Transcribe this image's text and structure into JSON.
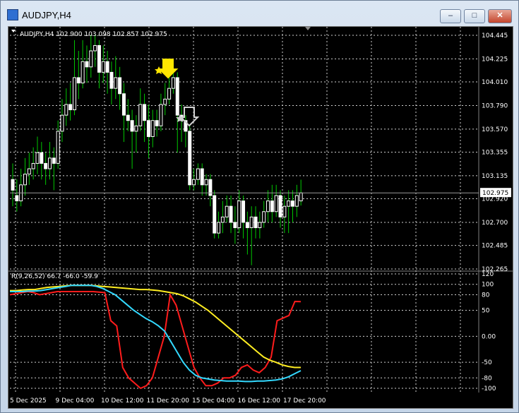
{
  "window": {
    "title": "AUDJPY,H4",
    "buttons": {
      "minimize": "–",
      "maximize": "□",
      "close": "✕"
    }
  },
  "chart": {
    "info_line": "AUDJPY,H4  102.900 103.098 102.857 102.975",
    "current_price": "102.975",
    "price_axis": [
      "104.445",
      "104.225",
      "104.010",
      "103.790",
      "103.570",
      "103.355",
      "103.135",
      "102.920",
      "102.700",
      "102.485",
      "102.265"
    ],
    "time_axis": [
      "5 Dec 2025",
      "9 Dec 04:00",
      "10 Dec 12:00",
      "11 Dec 20:00",
      "15 Dec 04:00",
      "16 Dec 12:00",
      "17 Dec 20:00"
    ],
    "indicator": {
      "label": "R(9,26,52) 66.7 -66.0 -59.9",
      "axis": [
        "120",
        "100",
        "80",
        "50",
        "0.00",
        "-50",
        "-80",
        "-100"
      ]
    },
    "arrows": [
      {
        "color": "#ffe600"
      },
      {
        "color": "#d0d0d0"
      }
    ]
  },
  "colors": {
    "up": "#ffffff",
    "down": "#ffffff",
    "wick": "#00c800",
    "red": "#ff1c1c",
    "yellow": "#ffee22",
    "cyan": "#33d9ff"
  },
  "chart_data": [
    {
      "type": "candlestick",
      "title": "AUDJPY,H4",
      "ylim": [
        102.265,
        104.445
      ],
      "y_ticks": [
        104.445,
        104.225,
        104.01,
        103.79,
        103.57,
        103.355,
        103.135,
        102.92,
        102.7,
        102.485,
        102.265
      ],
      "candles": [
        [
          103.1,
          103.0,
          103.25,
          102.85
        ],
        [
          102.95,
          102.9,
          103.1,
          102.8
        ],
        [
          102.9,
          103.05,
          103.2,
          102.85
        ],
        [
          103.05,
          103.15,
          103.3,
          102.95
        ],
        [
          103.15,
          103.2,
          103.35,
          103.05
        ],
        [
          103.2,
          103.25,
          103.4,
          103.1
        ],
        [
          103.25,
          103.35,
          103.5,
          103.15
        ],
        [
          103.35,
          103.25,
          103.45,
          103.1
        ],
        [
          103.25,
          103.2,
          103.35,
          103.05
        ],
        [
          103.2,
          103.3,
          103.45,
          103.1
        ],
        [
          103.3,
          103.25,
          103.4,
          103.0
        ],
        [
          103.25,
          103.55,
          103.65,
          103.2
        ],
        [
          103.55,
          103.7,
          103.85,
          103.45
        ],
        [
          103.7,
          103.8,
          103.95,
          103.6
        ],
        [
          103.8,
          103.75,
          104.0,
          103.65
        ],
        [
          103.75,
          104.05,
          104.4,
          103.7
        ],
        [
          104.05,
          104.0,
          104.3,
          103.85
        ],
        [
          104.0,
          104.2,
          104.4,
          103.95
        ],
        [
          104.2,
          104.15,
          104.35,
          104.0
        ],
        [
          104.15,
          104.3,
          104.45,
          104.05
        ],
        [
          104.3,
          104.35,
          104.45,
          104.15
        ],
        [
          104.35,
          104.1,
          104.4,
          103.95
        ],
        [
          104.1,
          104.2,
          104.35,
          104.0
        ],
        [
          104.2,
          104.1,
          104.3,
          103.9
        ],
        [
          104.1,
          103.95,
          104.2,
          103.8
        ],
        [
          103.95,
          104.05,
          104.25,
          103.85
        ],
        [
          104.05,
          103.9,
          104.15,
          103.75
        ],
        [
          103.9,
          103.7,
          104.0,
          103.45
        ],
        [
          103.7,
          103.65,
          103.85,
          103.55
        ],
        [
          103.65,
          103.55,
          103.75,
          103.2
        ],
        [
          103.55,
          103.6,
          103.7,
          103.35
        ],
        [
          103.6,
          103.8,
          103.95,
          103.55
        ],
        [
          103.8,
          103.65,
          103.9,
          103.45
        ],
        [
          103.65,
          103.5,
          103.8,
          103.3
        ],
        [
          103.5,
          103.65,
          103.75,
          103.4
        ],
        [
          103.65,
          103.6,
          103.75,
          103.5
        ],
        [
          103.6,
          103.8,
          103.9,
          103.55
        ],
        [
          103.8,
          103.85,
          104.0,
          103.7
        ],
        [
          103.85,
          103.95,
          104.1,
          103.8
        ],
        [
          103.95,
          104.05,
          104.15,
          103.9
        ],
        [
          104.05,
          103.7,
          104.1,
          103.35
        ],
        [
          103.7,
          103.65,
          103.8,
          103.45
        ],
        [
          103.65,
          103.55,
          103.7,
          103.4
        ],
        [
          103.55,
          103.05,
          103.6,
          103.0
        ],
        [
          103.05,
          103.1,
          103.2,
          103.0
        ],
        [
          103.1,
          103.2,
          103.25,
          103.05
        ],
        [
          103.2,
          103.05,
          103.25,
          102.95
        ],
        [
          103.05,
          103.1,
          103.15,
          102.95
        ],
        [
          103.1,
          102.95,
          103.15,
          102.85
        ],
        [
          102.95,
          102.6,
          103.0,
          102.55
        ],
        [
          102.6,
          102.7,
          102.8,
          102.55
        ],
        [
          102.7,
          102.75,
          102.9,
          102.6
        ],
        [
          102.75,
          102.85,
          102.95,
          102.7
        ],
        [
          102.85,
          102.7,
          102.95,
          102.6
        ],
        [
          102.7,
          102.65,
          102.85,
          102.5
        ],
        [
          102.65,
          102.9,
          103.0,
          102.6
        ],
        [
          102.9,
          102.7,
          102.95,
          102.55
        ],
        [
          102.7,
          102.65,
          102.8,
          102.4
        ],
        [
          102.65,
          102.75,
          102.85,
          102.3
        ],
        [
          102.75,
          102.65,
          102.85,
          102.55
        ],
        [
          102.65,
          102.7,
          102.8,
          102.55
        ],
        [
          102.7,
          102.8,
          102.9,
          102.65
        ],
        [
          102.8,
          102.9,
          103.0,
          102.7
        ],
        [
          102.9,
          102.8,
          103.05,
          102.7
        ],
        [
          102.8,
          102.95,
          103.05,
          102.75
        ],
        [
          102.95,
          102.75,
          103.0,
          102.65
        ],
        [
          102.75,
          102.85,
          102.95,
          102.6
        ],
        [
          102.85,
          102.9,
          103.0,
          102.6
        ],
        [
          102.9,
          102.85,
          103.0,
          102.7
        ],
        [
          102.85,
          102.95,
          103.05,
          102.75
        ],
        [
          102.9,
          102.975,
          103.098,
          102.857
        ]
      ]
    },
    {
      "type": "line",
      "title": "R(9,26,52)",
      "ylim": [
        -100,
        120
      ],
      "y_ticks": [
        120,
        100,
        80,
        50,
        0,
        -50,
        -80,
        -100
      ],
      "series": [
        {
          "name": "",
          "color": "red",
          "values": [
            80,
            82,
            84,
            86,
            84,
            80,
            82,
            84,
            86,
            86,
            86,
            86,
            86,
            86,
            86,
            85,
            84,
            30,
            20,
            -60,
            -80,
            -90,
            -100,
            -95,
            -80,
            -40,
            0,
            80,
            60,
            20,
            -20,
            -60,
            -80,
            -95,
            -95,
            -90,
            -80,
            -80,
            -75,
            -60,
            -55,
            -65,
            -70,
            -60,
            -40,
            30,
            35,
            40,
            67,
            66.7
          ]
        },
        {
          "name": "",
          "color": "yellow",
          "values": [
            88,
            88,
            89,
            90,
            90,
            92,
            94,
            95,
            96,
            97,
            98,
            98,
            98,
            98,
            97,
            96,
            95,
            94,
            93,
            92,
            91,
            90,
            90,
            89,
            88,
            86,
            84,
            82,
            78,
            72,
            66,
            58,
            50,
            40,
            30,
            20,
            10,
            0,
            -10,
            -20,
            -30,
            -40,
            -46,
            -50,
            -55,
            -58,
            -60,
            -59.9
          ]
        },
        {
          "name": "",
          "color": "cyan",
          "values": [
            86,
            86,
            86,
            87,
            87,
            88,
            90,
            92,
            94,
            96,
            98,
            98,
            98,
            98,
            96,
            92,
            86,
            80,
            70,
            60,
            50,
            42,
            34,
            28,
            20,
            10,
            -10,
            -30,
            -50,
            -65,
            -75,
            -80,
            -82,
            -84,
            -85,
            -86,
            -86,
            -86,
            -87,
            -87,
            -86,
            -86,
            -85,
            -84,
            -82,
            -78,
            -72,
            -66.0
          ]
        }
      ]
    }
  ]
}
